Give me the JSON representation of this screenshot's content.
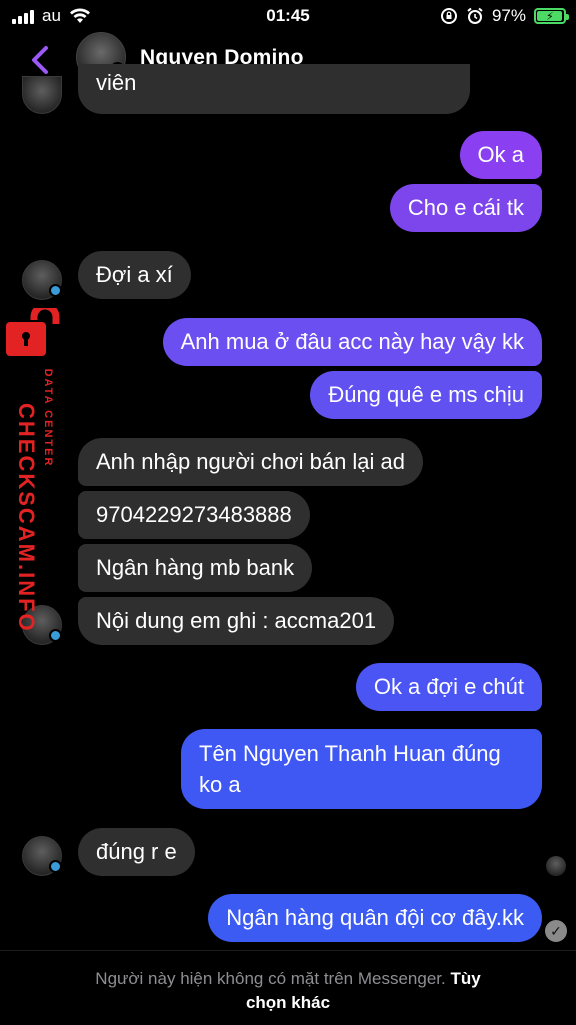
{
  "status_bar": {
    "carrier": "au",
    "time": "01:45",
    "battery": "97%",
    "battery_level": 0.97
  },
  "header": {
    "contact_name": "Nguyen Domino",
    "back_icon": "chevron-left-icon"
  },
  "watermark": {
    "main": "CHECKSCAM.INFO",
    "sub": "DATA CENTER"
  },
  "messages": [
    {
      "side": "in",
      "text": "viên",
      "partial": true
    },
    {
      "side": "out",
      "text": "Ok a"
    },
    {
      "side": "out",
      "text": "Cho e cái tk"
    },
    {
      "side": "in",
      "text": "Đợi a xí"
    },
    {
      "side": "out",
      "text": "Anh mua ở đâu acc này hay vậy kk"
    },
    {
      "side": "out",
      "text": "Đúng quê e ms chịu"
    },
    {
      "side": "in",
      "text": "Anh nhập người chơi bán lại ad"
    },
    {
      "side": "in",
      "text": "9704229273483888"
    },
    {
      "side": "in",
      "text": "Ngân hàng mb bank"
    },
    {
      "side": "in",
      "text": "Nội dung em ghi : accma201"
    },
    {
      "side": "out",
      "text": "Ok a đợi e chút"
    },
    {
      "side": "out",
      "text_line1": "Tên Nguyen Thanh Huan đúng",
      "text_line2": "ko a"
    },
    {
      "side": "in",
      "text": "đúng r e"
    },
    {
      "side": "out",
      "text": "Ngân hàng quân đội cơ đây.kk"
    }
  ],
  "footer": {
    "message": "Người này hiện không có mặt trên Messenger.",
    "link_part1": "Tùy",
    "link_part2": "chọn khác"
  },
  "colors": {
    "incoming_bubble": "#2f2f2f",
    "outgoing_purple": "#7c46ec",
    "outgoing_blue": "#3b5bf2",
    "back_chevron": "#9b59f5",
    "watermark_red": "#e32323"
  }
}
